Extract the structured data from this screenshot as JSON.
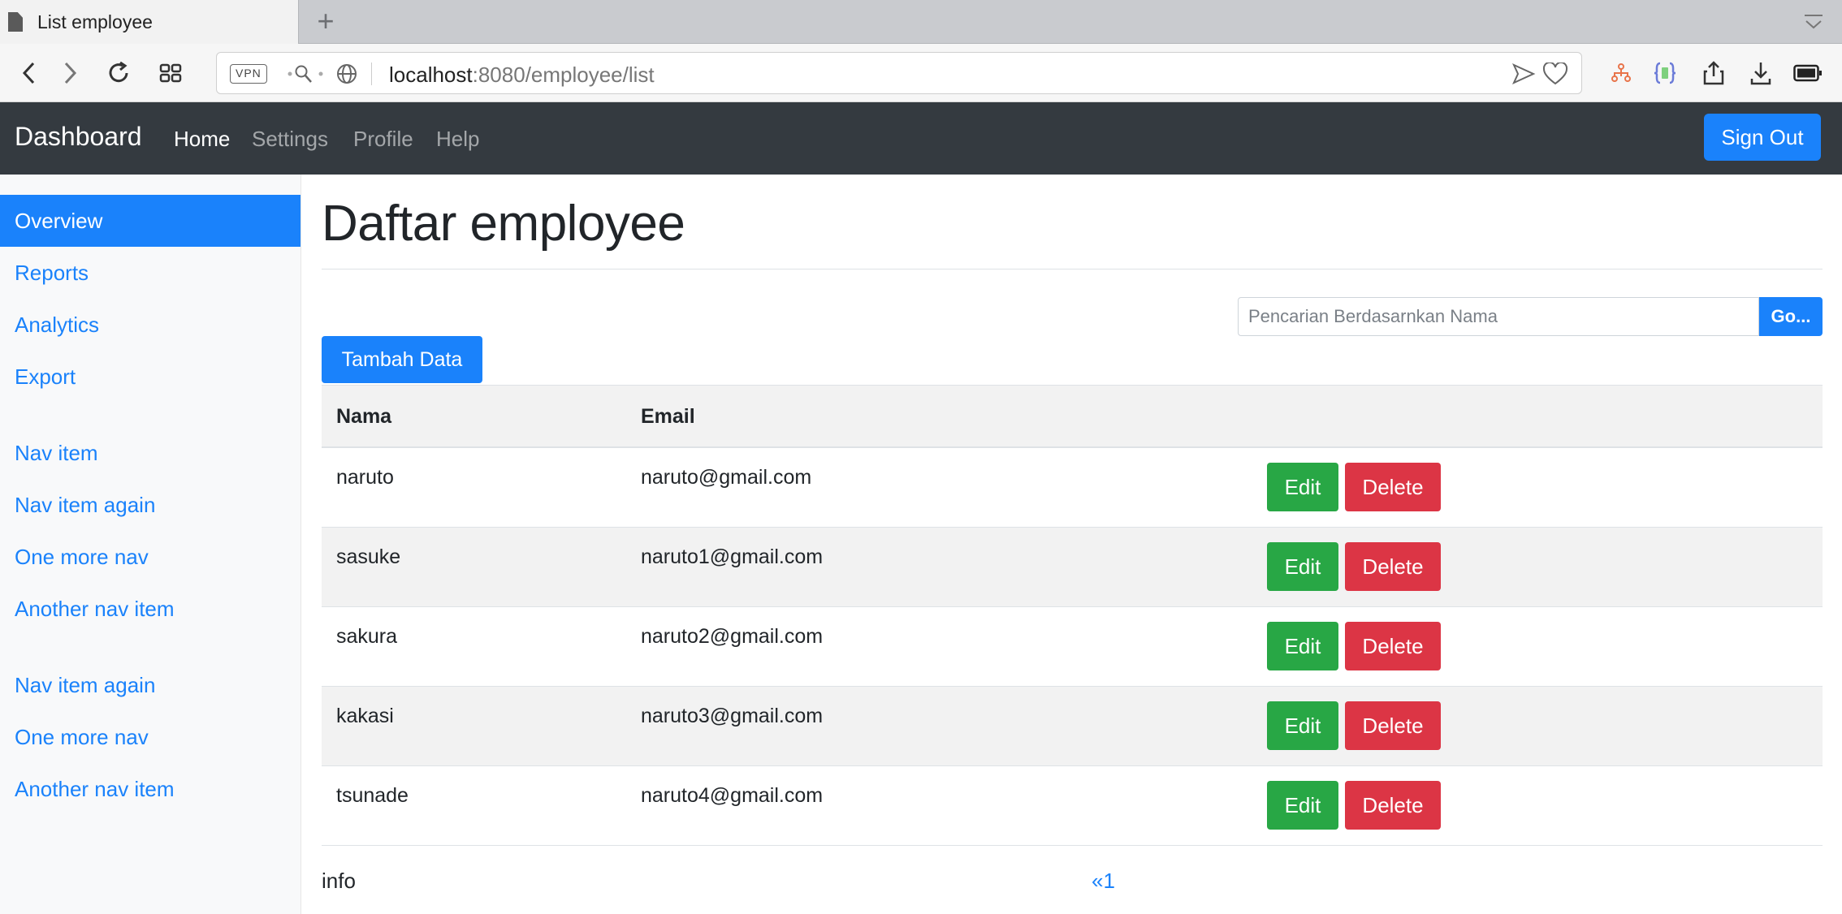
{
  "browser": {
    "tab_title": "List employee",
    "new_tab_symbol": "+",
    "vpn_label": "VPN",
    "url_host": "localhost",
    "url_rest": ":8080/employee/list"
  },
  "navbar": {
    "brand": "Dashboard",
    "links": [
      "Home",
      "Settings",
      "Profile",
      "Help"
    ],
    "active_link": "Home",
    "signout_label": "Sign Out"
  },
  "sidebar": {
    "items": [
      "Overview",
      "Reports",
      "Analytics",
      "Export",
      "Nav item",
      "Nav item again",
      "One more nav",
      "Another nav item",
      "Nav item again",
      "One more nav",
      "Another nav item"
    ],
    "active_item": "Overview"
  },
  "main": {
    "title": "Daftar employee",
    "search_placeholder": "Pencarian Berdasarnkan Nama",
    "go_label": "Go...",
    "add_label": "Tambah Data",
    "table": {
      "headers": [
        "Nama",
        "Email",
        ""
      ],
      "rows": [
        {
          "nama": "naruto",
          "email": "naruto@gmail.com"
        },
        {
          "nama": "sasuke",
          "email": "naruto1@gmail.com"
        },
        {
          "nama": "sakura",
          "email": "naruto2@gmail.com"
        },
        {
          "nama": "kakasi",
          "email": "naruto3@gmail.com"
        },
        {
          "nama": "tsunade",
          "email": "naruto4@gmail.com"
        }
      ],
      "edit_label": "Edit",
      "delete_label": "Delete"
    },
    "info_label": "info",
    "pagination": "«1"
  },
  "colors": {
    "primary": "#1a82fb",
    "success": "#28a745",
    "danger": "#dc3545",
    "navbar_bg": "#343a40"
  }
}
